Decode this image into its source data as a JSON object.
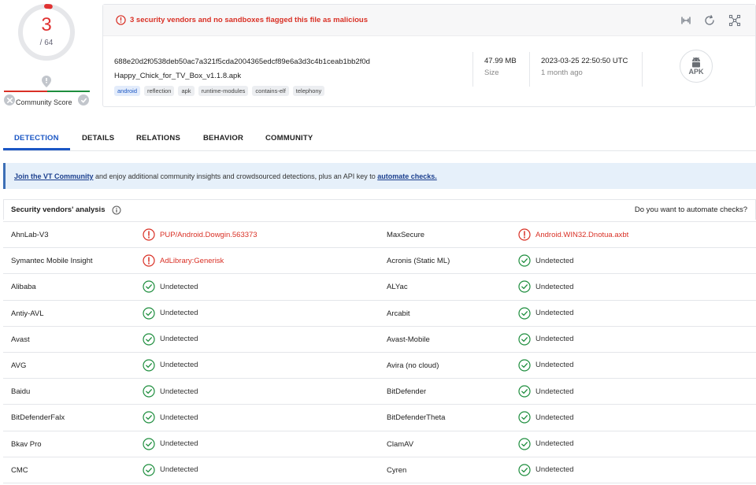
{
  "score": {
    "detections": "3",
    "total": "/ 64",
    "community_label": "Community Score",
    "malicious_fraction": 0.047
  },
  "alert": {
    "text": "3 security vendors and no sandboxes flagged this file as malicious"
  },
  "file": {
    "hash": "688e20d2f0538deb50ac7a321f5cda2004365edcf89e6a3d3c4b1ceab1bb2f0d",
    "name": "Happy_Chick_for_TV_Box_v1.1.8.apk",
    "tags": [
      "android",
      "reflection",
      "apk",
      "runtime-modules",
      "contains-elf",
      "telephony"
    ],
    "size_value": "47.99 MB",
    "size_label": "Size",
    "date_value": "2023-03-25 22:50:50 UTC",
    "date_relative": "1 month ago",
    "type_label": "APK"
  },
  "top_icons": [
    "reanalyze-icon",
    "refresh-icon",
    "graph-icon"
  ],
  "tabs": [
    "DETECTION",
    "DETAILS",
    "RELATIONS",
    "BEHAVIOR",
    "COMMUNITY"
  ],
  "banner": {
    "link1": "Join the VT Community",
    "middle": " and enjoy additional community insights and crowdsourced detections, plus an API key to ",
    "link2": "automate checks."
  },
  "vendors": {
    "title": "Security vendors' analysis",
    "automate_question": "Do you want to automate checks?",
    "rows": [
      [
        {
          "name": "AhnLab-V3",
          "result": "PUP/Android.Dowgin.563373",
          "status": "malicious"
        },
        {
          "name": "MaxSecure",
          "result": "Android.WIN32.Dnotua.axbt",
          "status": "malicious"
        }
      ],
      [
        {
          "name": "Symantec Mobile Insight",
          "result": "AdLibrary:Generisk",
          "status": "malicious"
        },
        {
          "name": "Acronis (Static ML)",
          "result": "Undetected",
          "status": "undetected"
        }
      ],
      [
        {
          "name": "Alibaba",
          "result": "Undetected",
          "status": "undetected"
        },
        {
          "name": "ALYac",
          "result": "Undetected",
          "status": "undetected"
        }
      ],
      [
        {
          "name": "Antiy-AVL",
          "result": "Undetected",
          "status": "undetected"
        },
        {
          "name": "Arcabit",
          "result": "Undetected",
          "status": "undetected"
        }
      ],
      [
        {
          "name": "Avast",
          "result": "Undetected",
          "status": "undetected"
        },
        {
          "name": "Avast-Mobile",
          "result": "Undetected",
          "status": "undetected"
        }
      ],
      [
        {
          "name": "AVG",
          "result": "Undetected",
          "status": "undetected"
        },
        {
          "name": "Avira (no cloud)",
          "result": "Undetected",
          "status": "undetected"
        }
      ],
      [
        {
          "name": "Baidu",
          "result": "Undetected",
          "status": "undetected"
        },
        {
          "name": "BitDefender",
          "result": "Undetected",
          "status": "undetected"
        }
      ],
      [
        {
          "name": "BitDefenderFalx",
          "result": "Undetected",
          "status": "undetected"
        },
        {
          "name": "BitDefenderTheta",
          "result": "Undetected",
          "status": "undetected"
        }
      ],
      [
        {
          "name": "Bkav Pro",
          "result": "Undetected",
          "status": "undetected"
        },
        {
          "name": "ClamAV",
          "result": "Undetected",
          "status": "undetected"
        }
      ],
      [
        {
          "name": "CMC",
          "result": "Undetected",
          "status": "undetected"
        },
        {
          "name": "Cyren",
          "result": "Undetected",
          "status": "undetected"
        }
      ]
    ]
  },
  "colors": {
    "malicious": "#d93025",
    "undetected": "#1e8e3e",
    "accent": "#1a56c4",
    "banner_bg": "#e6f0fa"
  }
}
